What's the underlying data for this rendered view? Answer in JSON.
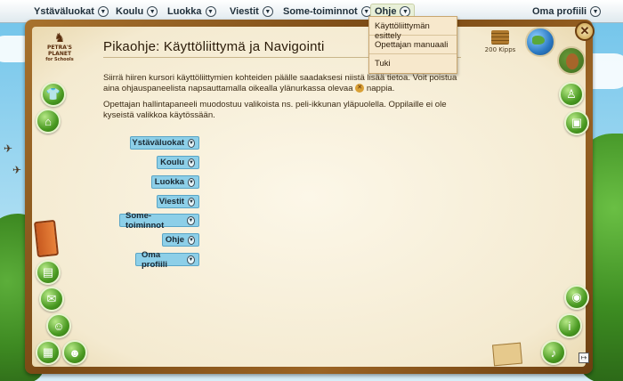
{
  "topbar": {
    "menus": [
      {
        "label": "Ystäväluokat"
      },
      {
        "label": "Koulu"
      },
      {
        "label": "Luokka"
      },
      {
        "label": "Viestit"
      },
      {
        "label": "Some-toiminnot"
      },
      {
        "label": "Ohje"
      },
      {
        "label": "Oma profiili"
      }
    ]
  },
  "logo": {
    "line1": "PETRA'S",
    "line2": "PLANET",
    "line3": "for Schools"
  },
  "page": {
    "title": "Pikaohje: Käyttöliittymä ja Navigointi",
    "para1_a": "Siirrä hiiren kursori käyttöliittymien kohteiden päälle saadaksesi niistä lisää tietoa. Voit poistua aina ohjauspaneelista napsauttamalla oikealla ylänurkassa olevaa",
    "para1_b": "nappia.",
    "para2": "Opettajan hallintapaneeli muodostuu valikoista ns. peli-ikkunan yläpuolella. Oppilaille ei ole kyseistä valikkoa käytössään."
  },
  "coins": {
    "label": "200 Kipps"
  },
  "dropdown": {
    "items": [
      {
        "label": "Käyttöliittymän esittely"
      },
      {
        "label": "Opettajan manuaali"
      },
      {
        "label": "Tuki"
      }
    ]
  },
  "nav_buttons": [
    {
      "label": "Ystäväluokat"
    },
    {
      "label": "Koulu"
    },
    {
      "label": "Luokka"
    },
    {
      "label": "Viestit"
    },
    {
      "label": "Some-toiminnot"
    },
    {
      "label": "Ohje"
    },
    {
      "label": "Oma profiili"
    }
  ],
  "icons": {
    "close": "close-icon",
    "globe": "globe-icon",
    "avatar": "avatar-icon"
  }
}
